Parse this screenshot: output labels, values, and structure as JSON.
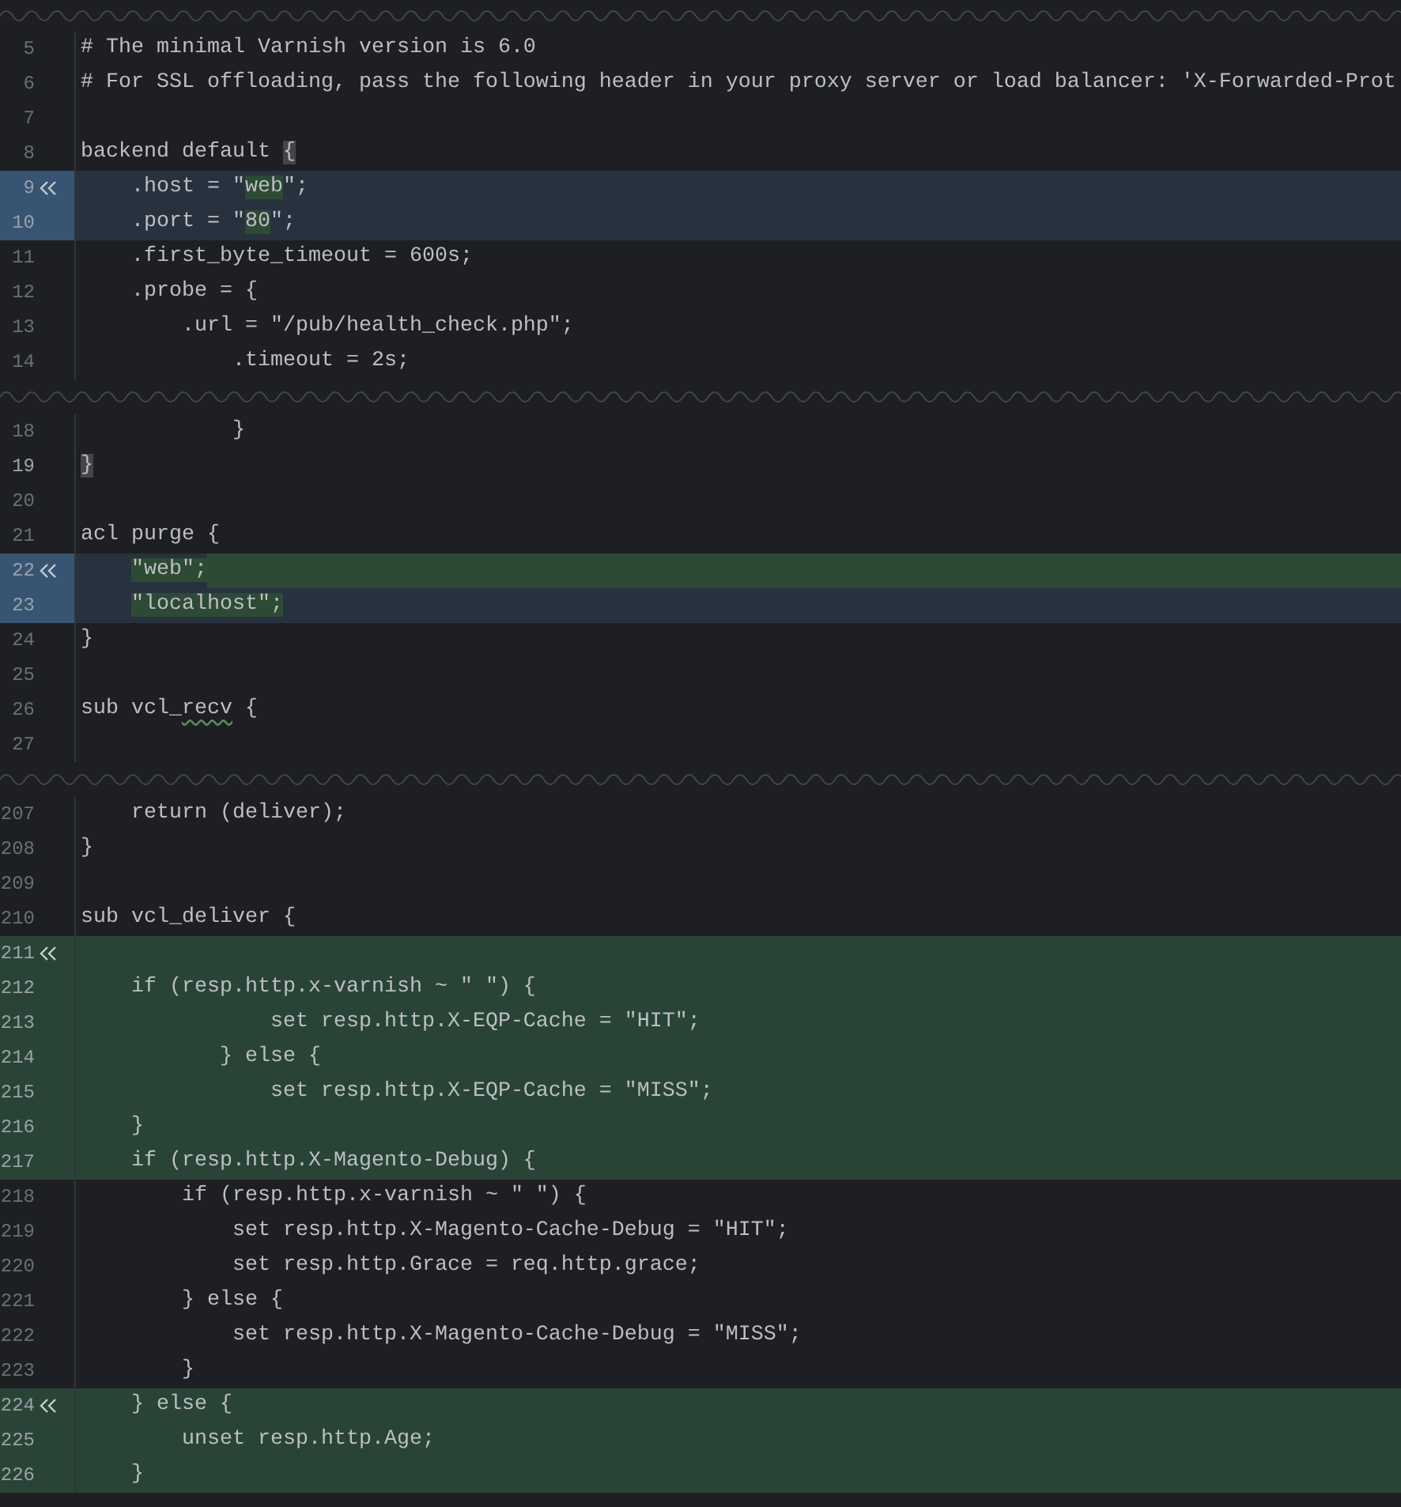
{
  "rows": [
    {
      "kind": "fold"
    },
    {
      "kind": "code",
      "number": "5",
      "modified": false,
      "inserted": false,
      "segments": [
        {
          "text": "# The minimal Varnish version is 6.0"
        }
      ]
    },
    {
      "kind": "code",
      "number": "6",
      "modified": false,
      "inserted": false,
      "segments": [
        {
          "text": "# For SSL offloading, pass the following header in your proxy server or load balancer: 'X-Forwarded-Prot"
        }
      ]
    },
    {
      "kind": "code",
      "number": "7",
      "modified": false,
      "inserted": false
    },
    {
      "kind": "code",
      "number": "8",
      "modified": false,
      "inserted": false,
      "segments": [
        {
          "text": "backend default "
        },
        {
          "text": "{",
          "brace_match": true
        }
      ]
    },
    {
      "kind": "code",
      "number": "9",
      "modified": true,
      "inserted": false,
      "chevron": true,
      "segments": [
        {
          "text": "    .host = \""
        },
        {
          "text": "web",
          "changed": true
        },
        {
          "text": "\";"
        }
      ]
    },
    {
      "kind": "code",
      "number": "10",
      "modified": true,
      "inserted": false,
      "segments": [
        {
          "text": "    .port = \""
        },
        {
          "text": "80",
          "changed": true
        },
        {
          "text": "\";"
        }
      ]
    },
    {
      "kind": "code",
      "number": "11",
      "modified": false,
      "inserted": false,
      "segments": [
        {
          "text": "    .first_byte_timeout = 600s;"
        }
      ]
    },
    {
      "kind": "code",
      "number": "12",
      "modified": false,
      "inserted": false,
      "segments": [
        {
          "text": "    .probe = {"
        }
      ]
    },
    {
      "kind": "code",
      "number": "13",
      "modified": false,
      "inserted": false,
      "segments": [
        {
          "text": "        .url = \"/pub/health_check.php\";"
        }
      ]
    },
    {
      "kind": "code",
      "number": "14",
      "modified": false,
      "inserted": false,
      "segments": [
        {
          "text": "            .timeout = 2s;"
        }
      ]
    },
    {
      "kind": "fold"
    },
    {
      "kind": "code",
      "number": "18",
      "modified": false,
      "inserted": false,
      "segments": [
        {
          "text": "            }"
        }
      ]
    },
    {
      "kind": "code",
      "number": "19",
      "modified": false,
      "inserted": false,
      "current": true,
      "segments": [
        {
          "text": "}",
          "brace_match": true
        }
      ]
    },
    {
      "kind": "code",
      "number": "20",
      "modified": false,
      "inserted": false
    },
    {
      "kind": "code",
      "number": "21",
      "modified": false,
      "inserted": false,
      "segments": [
        {
          "text": "acl purge {"
        }
      ]
    },
    {
      "kind": "code",
      "number": "22",
      "modified": true,
      "inserted": false,
      "chevron": true,
      "trailing_changed": true,
      "segments": [
        {
          "text": "    \"web\";",
          "changed": true
        }
      ]
    },
    {
      "kind": "code",
      "number": "23",
      "modified": true,
      "inserted": false,
      "trailing_changed": false,
      "segments": [
        {
          "text": "    \"localhost\";",
          "changed": true
        }
      ]
    },
    {
      "kind": "code",
      "number": "24",
      "modified": false,
      "inserted": false,
      "segments": [
        {
          "text": "}"
        }
      ]
    },
    {
      "kind": "code",
      "number": "25",
      "modified": false,
      "inserted": false
    },
    {
      "kind": "code",
      "number": "26",
      "modified": false,
      "inserted": false,
      "segments": [
        {
          "text": "sub vcl_"
        },
        {
          "text": "recv",
          "typo": true
        },
        {
          "text": " {"
        }
      ]
    },
    {
      "kind": "code",
      "number": "27",
      "modified": false,
      "inserted": false
    },
    {
      "kind": "fold"
    },
    {
      "kind": "code",
      "number": "207",
      "modified": false,
      "inserted": false,
      "segments": [
        {
          "text": "    return (deliver);"
        }
      ]
    },
    {
      "kind": "code",
      "number": "208",
      "modified": false,
      "inserted": false,
      "segments": [
        {
          "text": "}"
        }
      ]
    },
    {
      "kind": "code",
      "number": "209",
      "modified": false,
      "inserted": false
    },
    {
      "kind": "code",
      "number": "210",
      "modified": false,
      "inserted": false,
      "segments": [
        {
          "text": "sub vcl_deliver {"
        }
      ]
    },
    {
      "kind": "code",
      "number": "211",
      "modified": false,
      "inserted": true,
      "chevron": true
    },
    {
      "kind": "code",
      "number": "212",
      "modified": false,
      "inserted": true,
      "segments": [
        {
          "text": "    if (resp.http.x-varnish ~ \" \") {"
        }
      ]
    },
    {
      "kind": "code",
      "number": "213",
      "modified": false,
      "inserted": true,
      "segments": [
        {
          "text": "               set resp.http.X-EQP-Cache = \"HIT\";"
        }
      ]
    },
    {
      "kind": "code",
      "number": "214",
      "modified": false,
      "inserted": true,
      "segments": [
        {
          "text": "           } else {"
        }
      ]
    },
    {
      "kind": "code",
      "number": "215",
      "modified": false,
      "inserted": true,
      "segments": [
        {
          "text": "               set resp.http.X-EQP-Cache = \"MISS\";"
        }
      ]
    },
    {
      "kind": "code",
      "number": "216",
      "modified": false,
      "inserted": true,
      "segments": [
        {
          "text": "    }"
        }
      ]
    },
    {
      "kind": "code",
      "number": "217",
      "modified": false,
      "inserted": true,
      "segments": [
        {
          "text": "    if (resp.http.X-Magento-Debug) {"
        }
      ]
    },
    {
      "kind": "code",
      "number": "218",
      "modified": false,
      "inserted": false,
      "segments": [
        {
          "text": "        if (resp.http.x-varnish ~ \" \") {"
        }
      ]
    },
    {
      "kind": "code",
      "number": "219",
      "modified": false,
      "inserted": false,
      "segments": [
        {
          "text": "            set resp.http.X-Magento-Cache-Debug = \"HIT\";"
        }
      ]
    },
    {
      "kind": "code",
      "number": "220",
      "modified": false,
      "inserted": false,
      "segments": [
        {
          "text": "            set resp.http.Grace = req.http.grace;"
        }
      ]
    },
    {
      "kind": "code",
      "number": "221",
      "modified": false,
      "inserted": false,
      "segments": [
        {
          "text": "        } else {"
        }
      ]
    },
    {
      "kind": "code",
      "number": "222",
      "modified": false,
      "inserted": false,
      "segments": [
        {
          "text": "            set resp.http.X-Magento-Cache-Debug = \"MISS\";"
        }
      ]
    },
    {
      "kind": "code",
      "number": "223",
      "modified": false,
      "inserted": false,
      "segments": [
        {
          "text": "        }"
        }
      ]
    },
    {
      "kind": "code",
      "number": "224",
      "modified": false,
      "inserted": true,
      "chevron": true,
      "segments": [
        {
          "text": "    } else {"
        }
      ]
    },
    {
      "kind": "code",
      "number": "225",
      "modified": false,
      "inserted": true,
      "segments": [
        {
          "text": "        unset resp.http.Age;"
        }
      ]
    },
    {
      "kind": "code",
      "number": "226",
      "modified": false,
      "inserted": true,
      "segments": [
        {
          "text": "    }"
        }
      ]
    }
  ]
}
